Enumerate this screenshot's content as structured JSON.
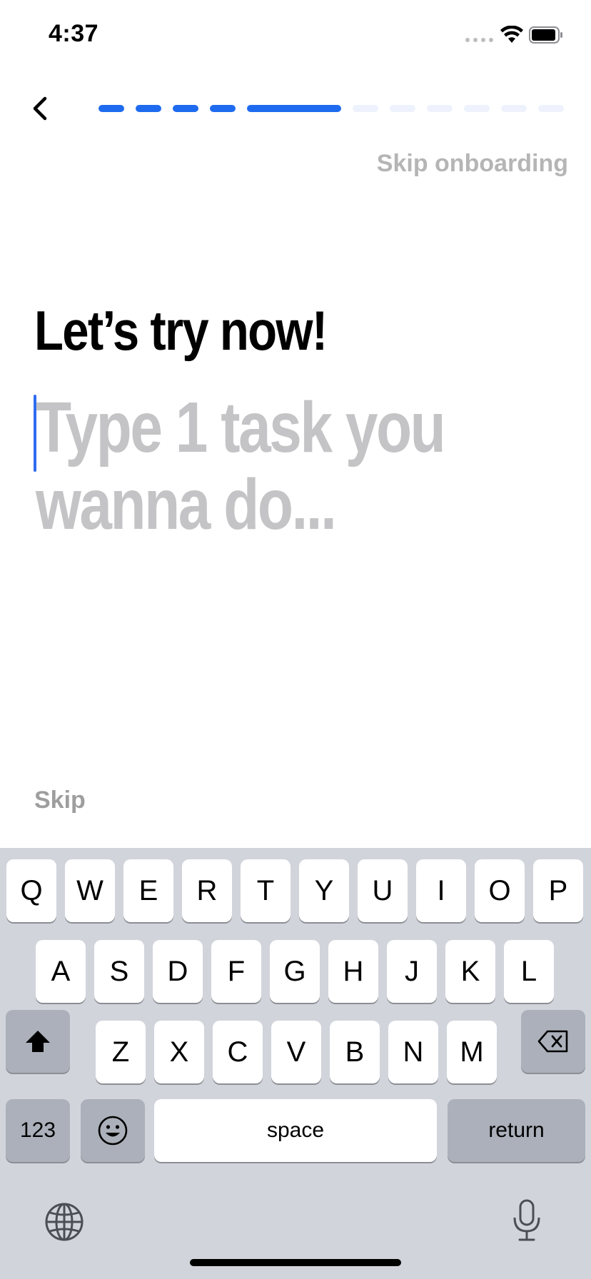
{
  "status_bar": {
    "time": "4:37"
  },
  "header": {
    "skip_onboarding_label": "Skip onboarding",
    "progress": {
      "total_steps": 11,
      "current_step": 5,
      "active_color": "#1f6bf0",
      "inactive_color": "#edf2fc"
    }
  },
  "main": {
    "headline": "Let’s try now!",
    "task_input": {
      "value": "",
      "placeholder": "Type 1 task you wanna do..."
    },
    "skip_label": "Skip"
  },
  "keyboard": {
    "row1": [
      "Q",
      "W",
      "E",
      "R",
      "T",
      "Y",
      "U",
      "I",
      "O",
      "P"
    ],
    "row2": [
      "A",
      "S",
      "D",
      "F",
      "G",
      "H",
      "J",
      "K",
      "L"
    ],
    "row3": [
      "Z",
      "X",
      "C",
      "V",
      "B",
      "N",
      "M"
    ],
    "numbers_label": "123",
    "space_label": "space",
    "return_label": "return"
  }
}
